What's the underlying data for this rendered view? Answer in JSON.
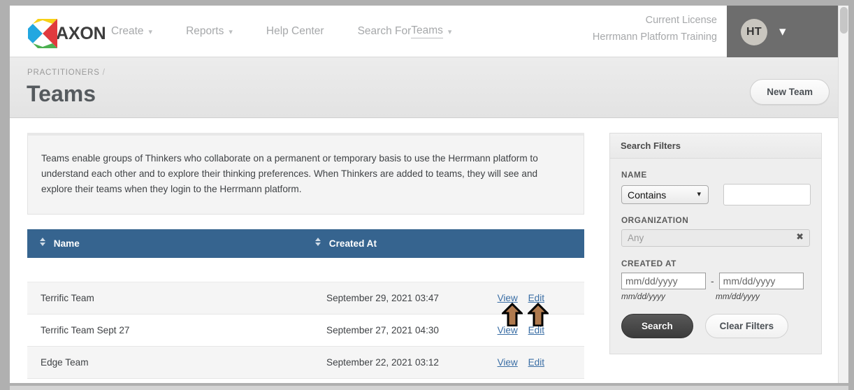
{
  "topnav": {
    "logo_text": "AXON",
    "logo_icon": "axon-diamond-logo",
    "items": [
      {
        "label": "Create",
        "has_caret": true,
        "underlined": ""
      },
      {
        "label": "Reports",
        "has_caret": true,
        "underlined": ""
      },
      {
        "label": "Help Center",
        "has_caret": false,
        "underlined": ""
      },
      {
        "label": "Search For ",
        "has_caret": true,
        "underlined": "Teams"
      }
    ],
    "license_label": "Current License",
    "license_value": "Herrmann Platform Training",
    "avatar_initials": "HT",
    "user_chevron_icon": "chevron-down-icon"
  },
  "pagehead": {
    "breadcrumb": "PRACTITIONERS",
    "breadcrumb_separator": "/",
    "title": "Teams",
    "new_team_label": "New Team"
  },
  "description": "Teams enable groups of Thinkers who collaborate on a permanent or temporary basis to use the Herrmann platform to understand each other and to explore their thinking preferences. When Thinkers are added to teams, they will see and explore their teams when they login to the Herrmann platform.",
  "table": {
    "columns": [
      {
        "label": "Name",
        "sort_icon": "sort-arrows-icon"
      },
      {
        "label": "Created At",
        "sort_icon": "sort-arrows-icon"
      }
    ],
    "rows": [
      {
        "name": "Terrific Team",
        "created_at": "September 29, 2021 03:47",
        "view": "View",
        "edit": "Edit"
      },
      {
        "name": "Terrific Team Sept 27",
        "created_at": "September 27, 2021 04:30",
        "view": "View",
        "edit": "Edit"
      },
      {
        "name": "Edge Team",
        "created_at": "September 22, 2021 03:12",
        "view": "View",
        "edit": "Edit"
      }
    ]
  },
  "annotations": [
    {
      "icon": "up-arrow-annotation",
      "target": "view-link",
      "color": "#b07a4e"
    },
    {
      "icon": "up-arrow-annotation",
      "target": "edit-link",
      "color": "#b07a4e"
    }
  ],
  "filters": {
    "header": "Search Filters",
    "name_label": "NAME",
    "name_operator": "Contains",
    "name_operator_options": [
      "Contains"
    ],
    "name_value": "",
    "name_chevron_icon": "chevron-down-icon",
    "organization_label": "ORGANIZATION",
    "organization_placeholder": "Any",
    "organization_value": "",
    "organization_clear_icon": "clear-x-icon",
    "created_at_label": "CREATED AT",
    "date_from_placeholder": "mm/dd/yyyy",
    "date_from_value": "",
    "date_to_placeholder": "mm/dd/yyyy",
    "date_to_value": "",
    "date_separator": "-",
    "date_from_hint": "mm/dd/yyyy",
    "date_to_hint": "mm/dd/yyyy",
    "search_label": "Search",
    "clear_label": "Clear Filters"
  },
  "colors": {
    "table_header_blue": "#36648f",
    "link_blue": "#3a6ea5",
    "user_panel_gray": "#6d6d6d",
    "annotation_brown": "#b07a4e"
  }
}
